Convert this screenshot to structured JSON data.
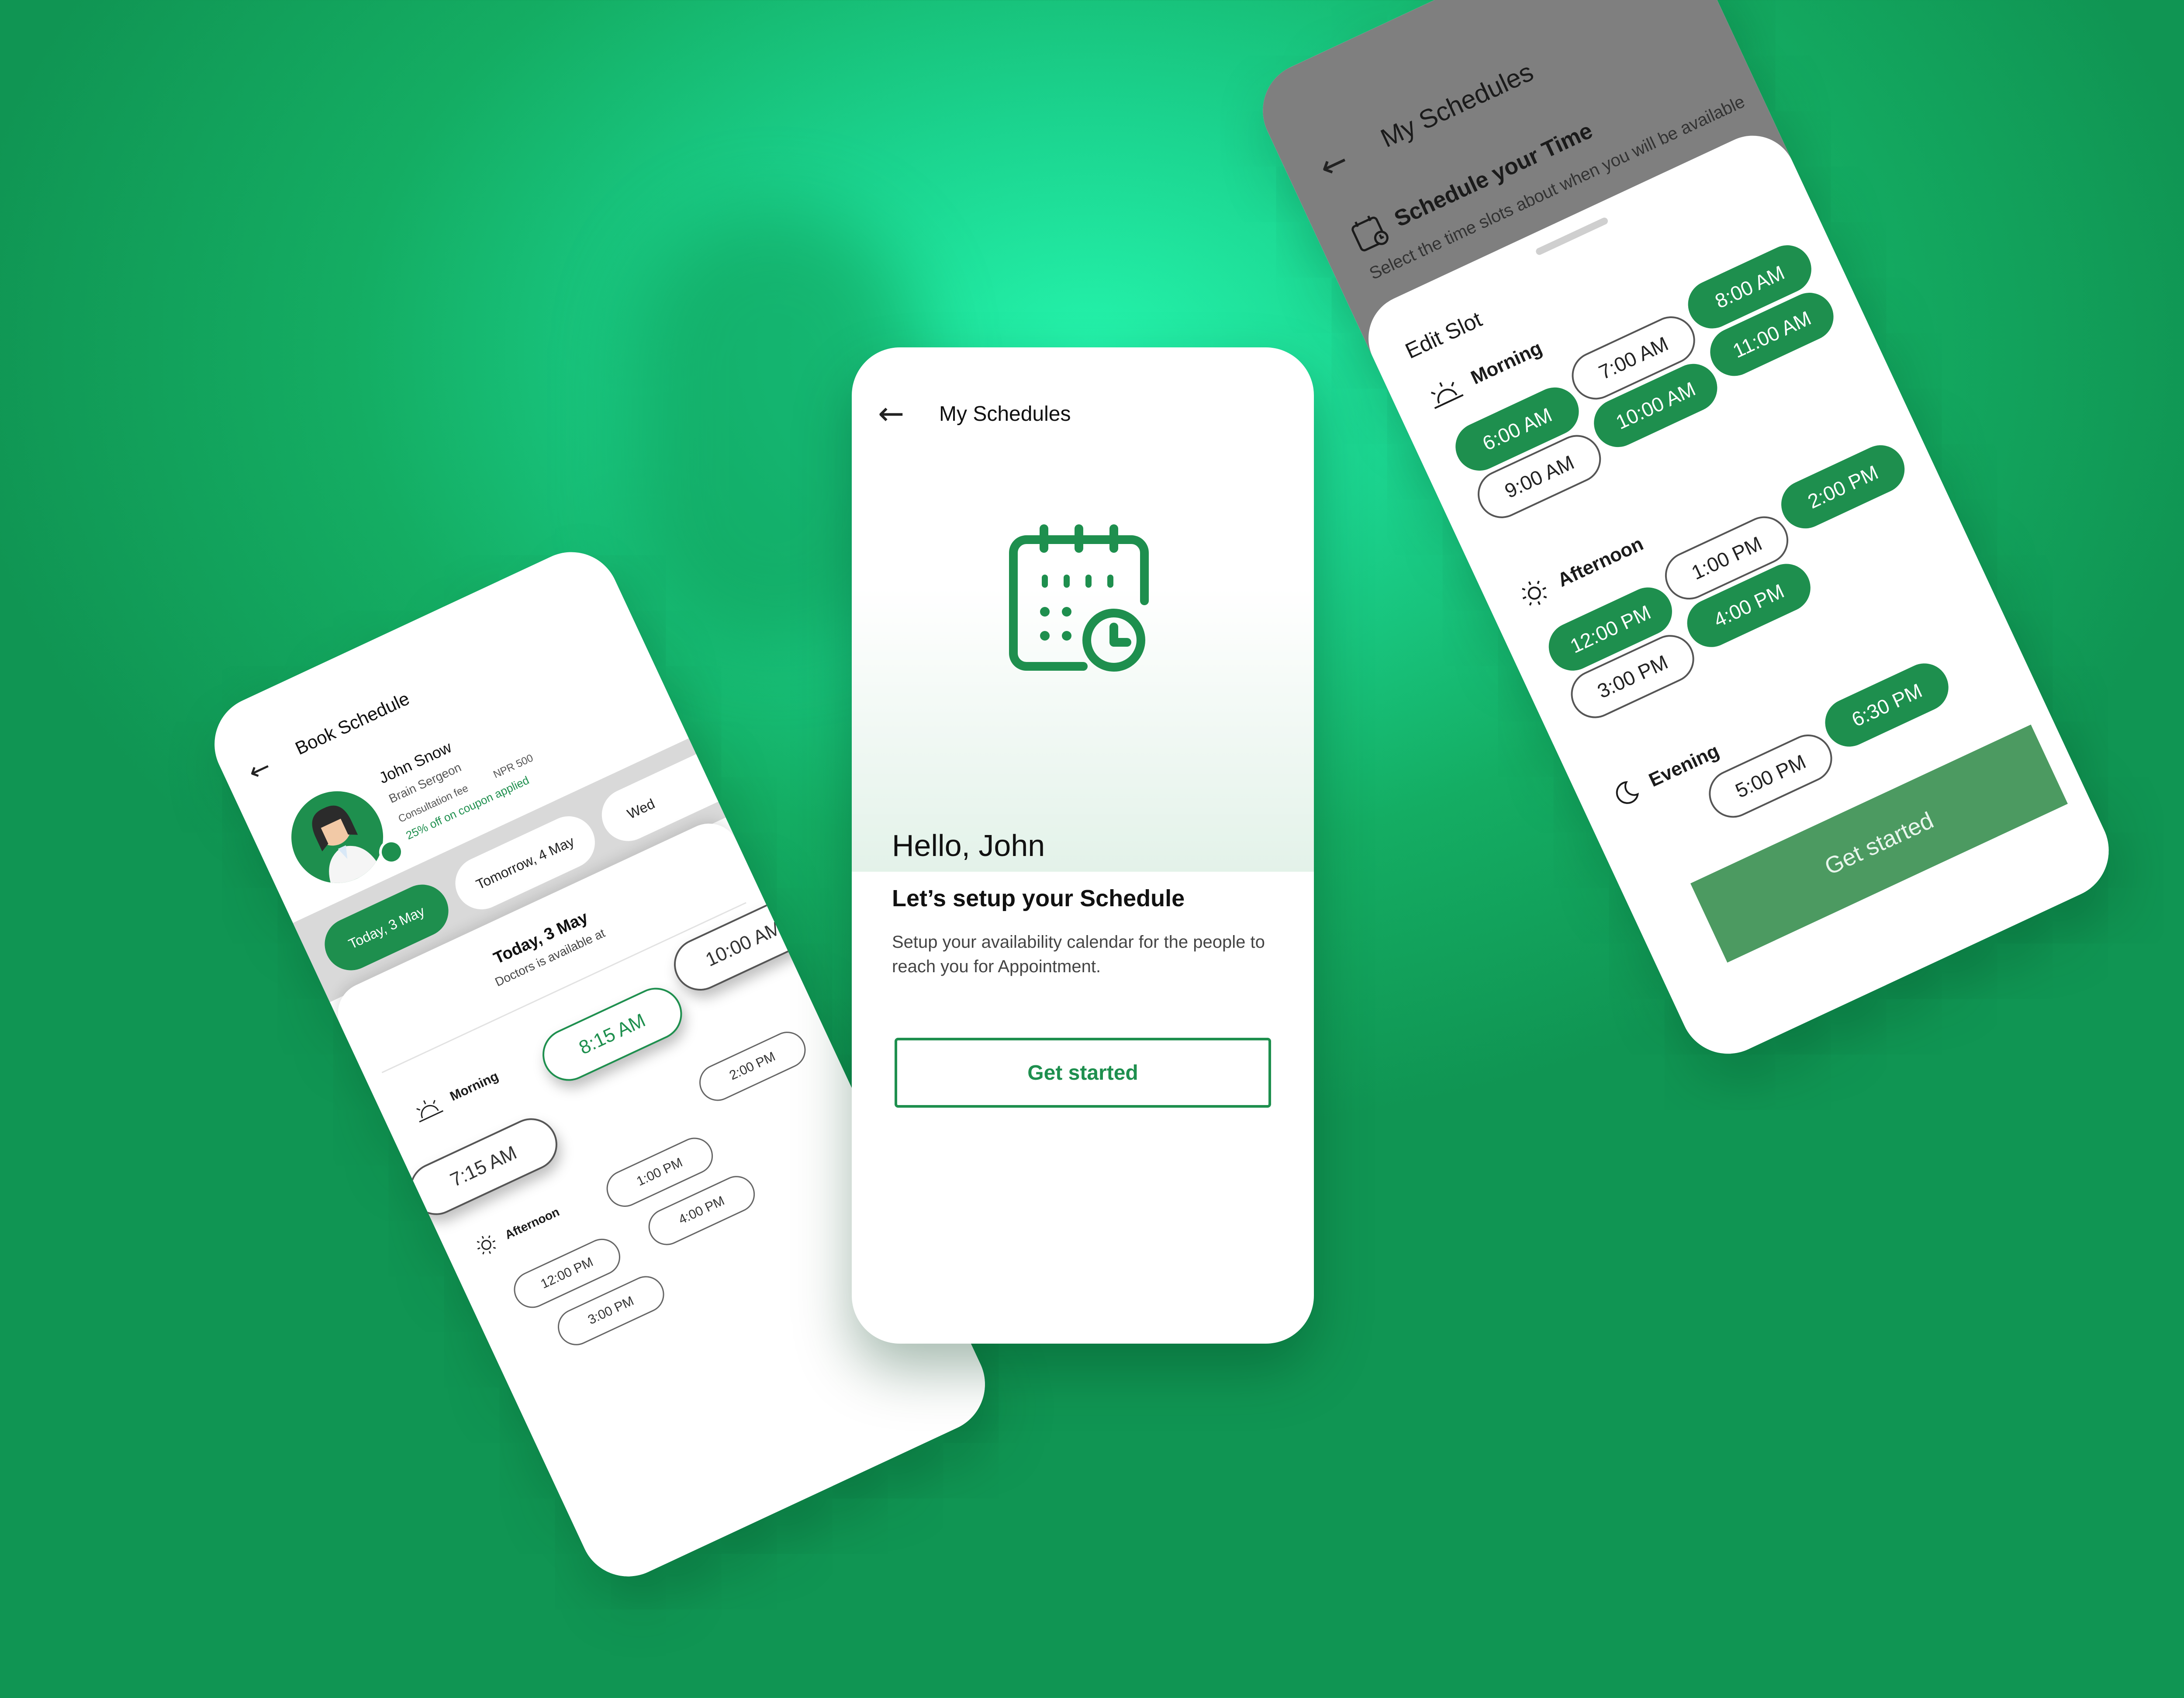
{
  "center": {
    "header_title": "My Schedules",
    "hello": "Hello, John",
    "setup_title": "Let’s setup your Schedule",
    "setup_desc": "Setup your availability calendar for the people to reach you for Appointment.",
    "cta": "Get started"
  },
  "right": {
    "header_title": "My Schedules",
    "schedule_title": "Schedule your Time",
    "schedule_desc": "Select the time slots about when you will be available",
    "edit_slot": "Edit Slot",
    "sections": {
      "morning": "Morning",
      "afternoon": "Afternoon",
      "evening": "Evening"
    },
    "morning_slots": [
      "6:00 AM",
      "7:00 AM",
      "8:00 AM",
      "9:00 AM",
      "10:00 AM",
      "11:00 AM"
    ],
    "afternoon_slots": [
      "12:00 PM",
      "1:00 PM",
      "2:00 PM",
      "3:00 PM",
      "4:00 PM"
    ],
    "evening_slots": [
      "5:00 PM",
      "6:30 PM"
    ],
    "cta": "Get started"
  },
  "left": {
    "header_title": "Book Schedule",
    "doctor": {
      "name": "John Snow",
      "role": "Brain Sergeon",
      "fee_label": "Consultation fee",
      "fee_value": "NPR 500",
      "coupon": "25% off on coupon applied"
    },
    "dates": [
      "Today, 3 May",
      "Tomorrow, 4 May",
      "Wed"
    ],
    "selected_date": "Today, 3 May",
    "availability": "Doctors is available at",
    "morning_label": "Morning",
    "morning_slots": [
      "7:15 AM",
      "8:15 AM",
      "10:00 AM"
    ],
    "afternoon_label": "Afternoon",
    "afternoon_slots": [
      "12:00 PM",
      "1:00 PM",
      "2:00 PM",
      "3:00 PM",
      "4:00 PM"
    ]
  },
  "colors": {
    "accent": "#1e8f4e",
    "bg": "#17b86b"
  }
}
